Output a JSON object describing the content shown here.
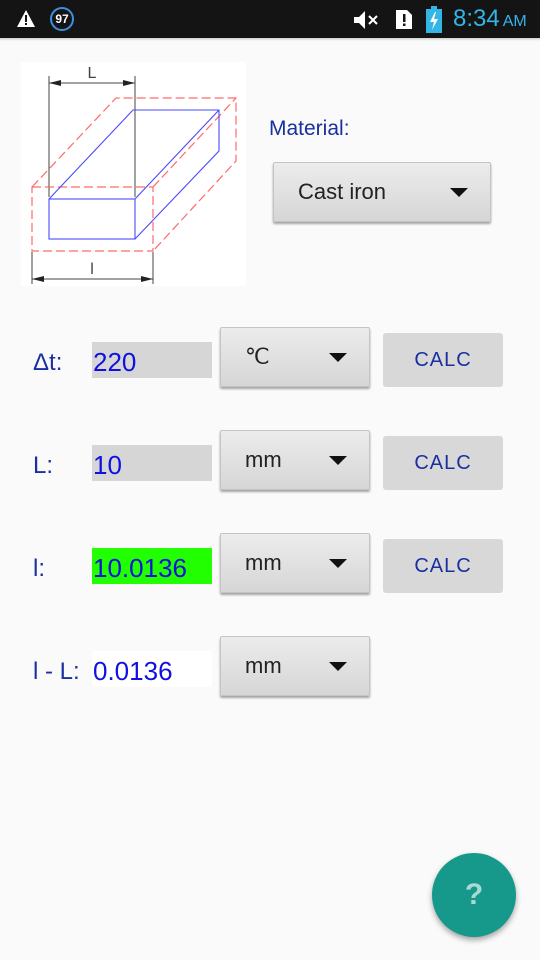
{
  "status_bar": {
    "notification_count": "97",
    "time": "8:34",
    "ampm": "AM",
    "icons": [
      "warning-icon",
      "notification-badge",
      "mute-icon",
      "sim-alert-icon",
      "battery-charging-icon"
    ]
  },
  "diagram": {
    "label_top": "L",
    "label_bottom": "l",
    "colors": {
      "original": "#4a4aff",
      "expanded": "#ff6a6a",
      "dimension": "#444444"
    }
  },
  "material": {
    "label": "Material:",
    "selected": "Cast iron"
  },
  "rows": [
    {
      "label": "Δt:",
      "value": "220",
      "unit": "℃",
      "calc_label": "CALC",
      "field_bg": "#d6d6d6"
    },
    {
      "label": "L:",
      "value": "10",
      "unit": "mm",
      "calc_label": "CALC",
      "field_bg": "#d6d6d6"
    },
    {
      "label": "l:",
      "value": "10.0136",
      "unit": "mm",
      "calc_label": "CALC",
      "field_bg": "#22ff00"
    },
    {
      "label": "l - L:",
      "value": "0.0136",
      "unit": "mm",
      "field_bg": "#ffffff"
    }
  ],
  "help_button": {
    "label": "?",
    "color": "#16998a"
  }
}
